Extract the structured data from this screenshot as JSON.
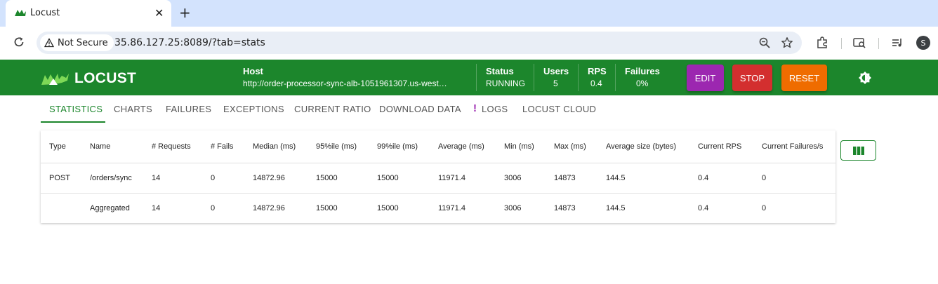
{
  "browser": {
    "tab_title": "Locust",
    "tab_close": "✕",
    "new_tab": "+",
    "security_label": "Not Secure",
    "url": "35.86.127.25:8089/?tab=stats",
    "profile_initial": "S"
  },
  "header": {
    "logo_text": "LOCUST",
    "host_label": "Host",
    "host_value": "http://order-processor-sync-alb-1051961307.us-west…",
    "status_label": "Status",
    "status_value": "RUNNING",
    "users_label": "Users",
    "users_value": "5",
    "rps_label": "RPS",
    "rps_value": "0.4",
    "failures_label": "Failures",
    "failures_value": "0%",
    "edit_label": "EDIT",
    "stop_label": "STOP",
    "reset_label": "RESET",
    "colors": {
      "header_bg": "#1c862c",
      "edit": "#9c27b0",
      "stop": "#d32f2f",
      "reset": "#ef6c00"
    }
  },
  "tabs": [
    {
      "label": "STATISTICS",
      "active": true
    },
    {
      "label": "CHARTS"
    },
    {
      "label": "FAILURES"
    },
    {
      "label": "EXCEPTIONS"
    },
    {
      "label": "CURRENT RATIO"
    },
    {
      "label": "DOWNLOAD DATA"
    },
    {
      "label": "LOGS",
      "alert": "!"
    },
    {
      "label": "LOCUST CLOUD"
    }
  ],
  "table": {
    "columns": [
      "Type",
      "Name",
      "# Requests",
      "# Fails",
      "Median (ms)",
      "95%ile (ms)",
      "99%ile (ms)",
      "Average (ms)",
      "Min (ms)",
      "Max (ms)",
      "Average size (bytes)",
      "Current RPS",
      "Current Failures/s"
    ],
    "rows": [
      [
        "POST",
        "/orders/sync",
        "14",
        "0",
        "14872.96",
        "15000",
        "15000",
        "11971.4",
        "3006",
        "14873",
        "144.5",
        "0.4",
        "0"
      ],
      [
        "",
        "Aggregated",
        "14",
        "0",
        "14872.96",
        "15000",
        "15000",
        "11971.4",
        "3006",
        "14873",
        "144.5",
        "0.4",
        "0"
      ]
    ]
  }
}
